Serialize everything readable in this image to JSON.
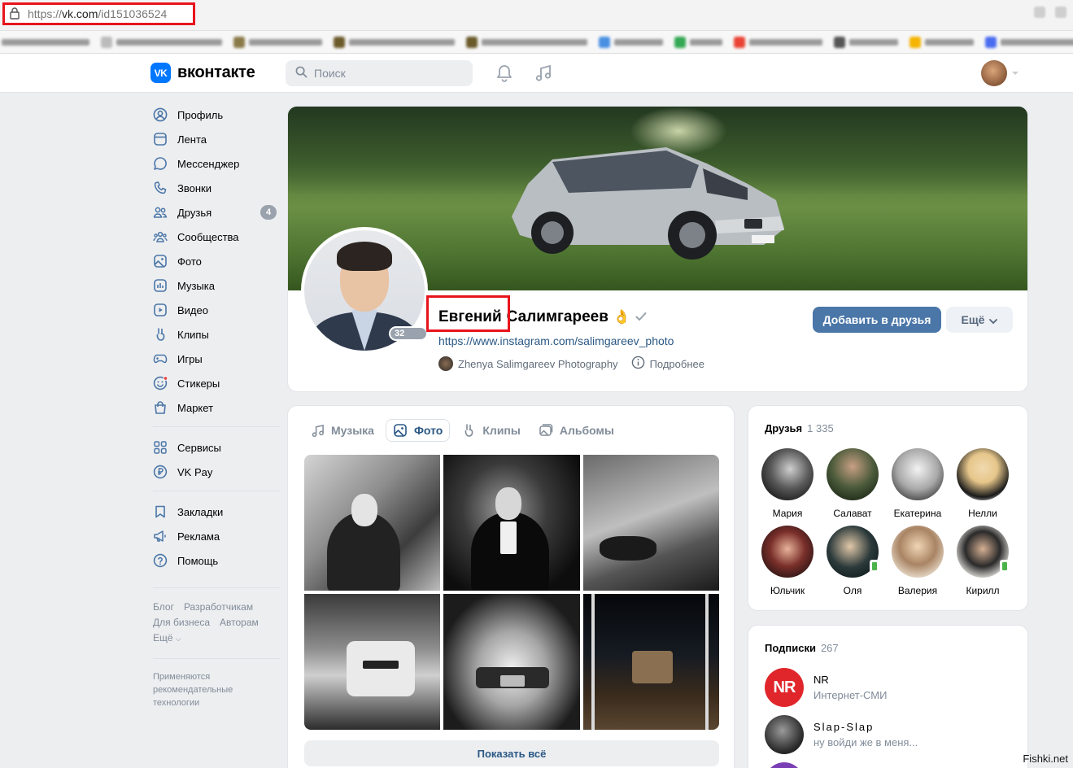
{
  "browser": {
    "url_proto": "https://",
    "url_host": "vk.com",
    "url_path": "/id151036524"
  },
  "header": {
    "logo_text": "вконтакте",
    "logo_mark": "VK",
    "search_placeholder": "Поиск"
  },
  "sidebar": {
    "items": [
      {
        "label": "Профиль",
        "icon": "profile-icon"
      },
      {
        "label": "Лента",
        "icon": "feed-icon"
      },
      {
        "label": "Мессенджер",
        "icon": "messenger-icon"
      },
      {
        "label": "Звонки",
        "icon": "phone-icon"
      },
      {
        "label": "Друзья",
        "icon": "friends-icon",
        "badge": "4"
      },
      {
        "label": "Сообщества",
        "icon": "communities-icon"
      },
      {
        "label": "Фото",
        "icon": "photo-icon"
      },
      {
        "label": "Музыка",
        "icon": "music-icon"
      },
      {
        "label": "Видео",
        "icon": "video-icon"
      },
      {
        "label": "Клипы",
        "icon": "clips-icon"
      },
      {
        "label": "Игры",
        "icon": "games-icon"
      },
      {
        "label": "Стикеры",
        "icon": "stickers-icon"
      },
      {
        "label": "Маркет",
        "icon": "market-icon"
      }
    ],
    "items2": [
      {
        "label": "Сервисы",
        "icon": "services-icon"
      },
      {
        "label": "VK Pay",
        "icon": "vkpay-icon"
      }
    ],
    "items3": [
      {
        "label": "Закладки",
        "icon": "bookmarks-icon"
      },
      {
        "label": "Реклама",
        "icon": "ads-icon"
      },
      {
        "label": "Помощь",
        "icon": "help-icon"
      }
    ],
    "footer_links": [
      "Блог",
      "Разработчикам",
      "Для бизнеса",
      "Авторам",
      "Ещё"
    ],
    "footnote": "Применяются рекомендательные технологии"
  },
  "profile": {
    "first_name": "Евгений",
    "last_name": "Салимгареев",
    "emoji": "👌",
    "online": "32 мин",
    "link": "https://www.instagram.com/salimgareev_photo",
    "page_name": "Zhenya Salimgareev Photography",
    "more_info": "Подробнее",
    "add_friend": "Добавить в друзья",
    "more": "Ещё"
  },
  "media": {
    "tabs": [
      {
        "label": "Музыка",
        "icon": "music-icon",
        "active": false
      },
      {
        "label": "Фото",
        "icon": "photo-icon",
        "active": true
      },
      {
        "label": "Клипы",
        "icon": "clips-icon",
        "active": false
      },
      {
        "label": "Альбомы",
        "icon": "albums-icon",
        "active": false
      }
    ],
    "show_all": "Показать всё"
  },
  "friends": {
    "title": "Друзья",
    "count": "1 335",
    "list": [
      {
        "name": "Мария",
        "mobile": false
      },
      {
        "name": "Салават",
        "mobile": false
      },
      {
        "name": "Екатерина",
        "mobile": false
      },
      {
        "name": "Нелли",
        "mobile": false
      },
      {
        "name": "Юльчик",
        "mobile": false
      },
      {
        "name": "Оля",
        "mobile": true
      },
      {
        "name": "Валерия",
        "mobile": false
      },
      {
        "name": "Кирилл",
        "mobile": true
      }
    ]
  },
  "subscriptions": {
    "title": "Подписки",
    "count": "267",
    "list": [
      {
        "name": "NR",
        "desc": "Интернет-СМИ",
        "logo_text": "NR"
      },
      {
        "name": "Slap-Slap",
        "desc": "ну войди же в меня..."
      }
    ]
  },
  "watermark": "Fishki.net",
  "colors": {
    "accent": "#4a76a8",
    "link": "#2a5885",
    "highlight_red": "#e8141c",
    "vk_blue": "#0077ff"
  }
}
